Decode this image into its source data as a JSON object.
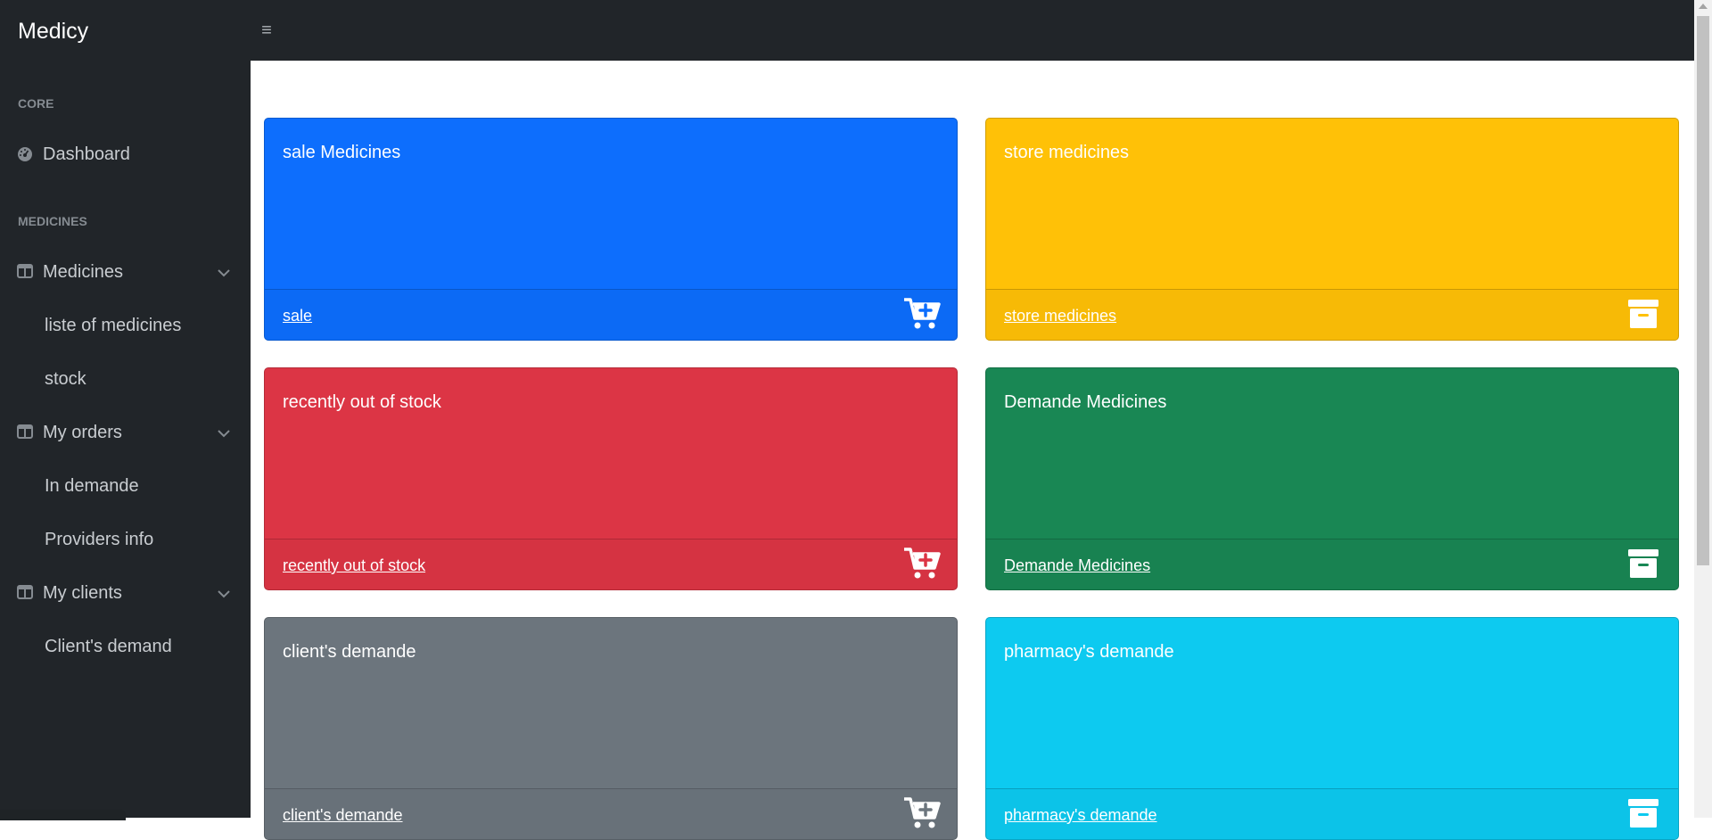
{
  "header": {
    "brand": "Medicy",
    "toggle_icon": "≡"
  },
  "sidebar": {
    "sections": [
      {
        "heading": "CORE"
      },
      {
        "heading": "MEDICINES"
      }
    ],
    "items": {
      "dashboard": {
        "label": "Dashboard",
        "icon": "tachometer-icon"
      },
      "medicines": {
        "label": "Medicines",
        "icon": "columns-icon",
        "children": [
          "liste of medicines",
          "stock"
        ]
      },
      "orders": {
        "label": "My orders",
        "icon": "columns-icon",
        "children": [
          "In demande",
          "Providers info"
        ]
      },
      "clients": {
        "label": "My clients",
        "icon": "columns-icon",
        "children": [
          "Client's demand"
        ]
      }
    }
  },
  "cards": [
    {
      "title": "sale Medicines",
      "link": "sale",
      "color": "#0d6efd",
      "icon": "cart-plus-icon"
    },
    {
      "title": "store medicines",
      "link": "store medicines",
      "color": "#ffc107",
      "icon": "archive-box-icon"
    },
    {
      "title": "recently out of stock",
      "link": "recently out of stock",
      "color": "#dc3545",
      "icon": "cart-plus-icon"
    },
    {
      "title": "Demande Medicines",
      "link": "Demande Medicines",
      "color": "#198754",
      "icon": "archive-box-icon"
    },
    {
      "title": "client's demande",
      "link": "client's demande",
      "color": "#6c757d",
      "icon": "cart-plus-icon"
    },
    {
      "title": "pharmacy's demande",
      "link": "pharmacy's demande",
      "color": "#0dcaf0",
      "icon": "archive-box-icon"
    }
  ]
}
